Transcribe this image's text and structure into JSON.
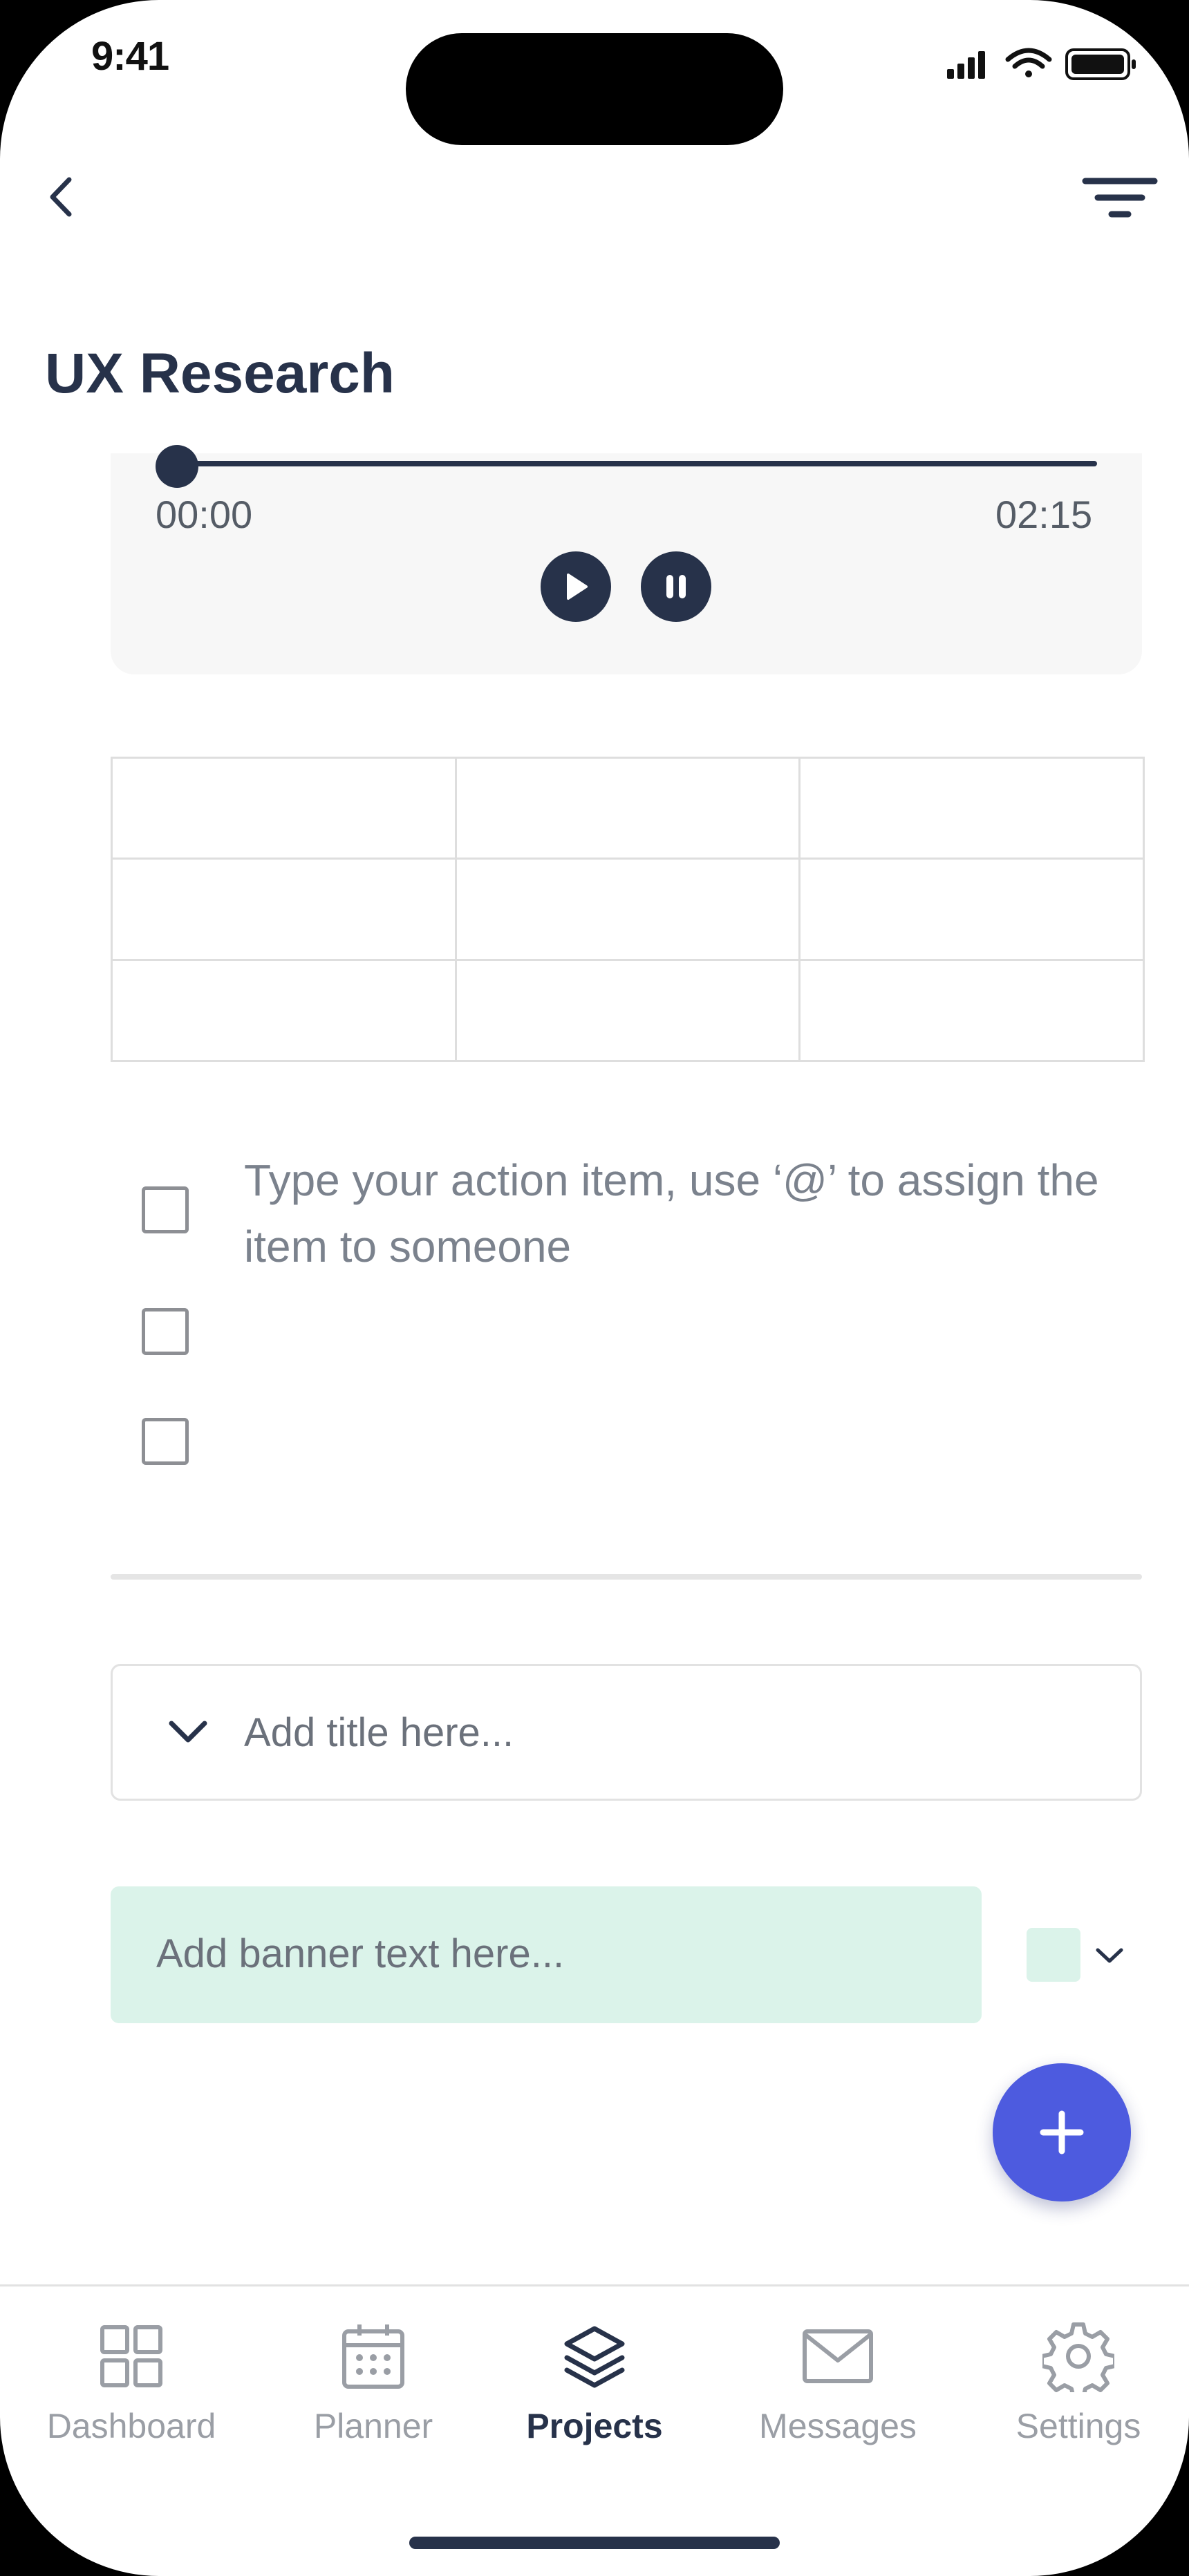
{
  "status_bar": {
    "time": "9:41"
  },
  "header": {
    "title": "UX Research"
  },
  "audio": {
    "start_time": "00:00",
    "end_time": "02:15",
    "progress": 0
  },
  "table": {
    "rows": 3,
    "cols": 3
  },
  "checklist": {
    "placeholder": "Type your action item, use ‘@’ to assign the item to someone",
    "items_checked": [
      false,
      false,
      false
    ]
  },
  "accordion": {
    "placeholder": "Add title here..."
  },
  "banner": {
    "placeholder": "Add banner text here...",
    "color": "#dbf3ea"
  },
  "colors": {
    "primary": "#27324a",
    "accent": "#4d5bdf",
    "muted": "#9a9ea5"
  },
  "nav": {
    "items": [
      {
        "label": "Dashboard",
        "icon": "grid-icon",
        "active": false
      },
      {
        "label": "Planner",
        "icon": "calendar-icon",
        "active": false
      },
      {
        "label": "Projects",
        "icon": "layers-icon",
        "active": true
      },
      {
        "label": "Messages",
        "icon": "mail-icon",
        "active": false
      },
      {
        "label": "Settings",
        "icon": "gear-icon",
        "active": false
      }
    ]
  }
}
